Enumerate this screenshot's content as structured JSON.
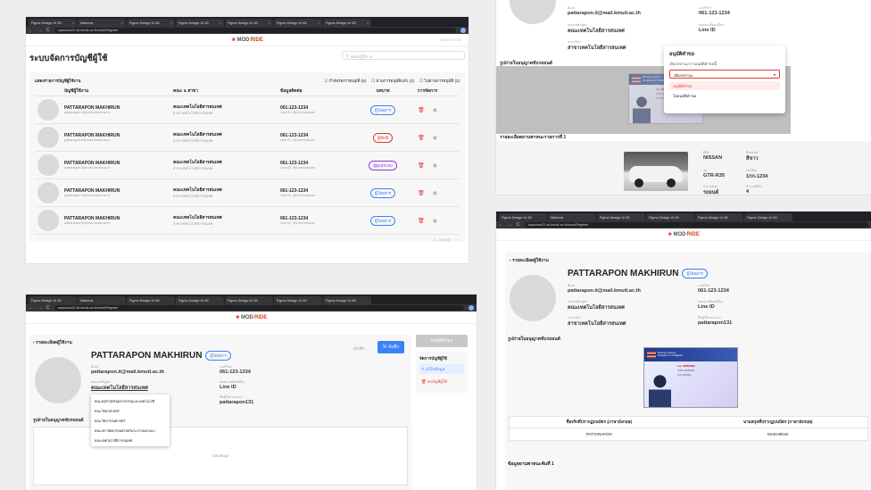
{
  "browser": {
    "tab_labels": [
      "Figma Design UI 65",
      "Mainmal",
      "Figma Design UI 65",
      "Figma Design UI 65",
      "Figma Design UI 65",
      "Figma Design UI 65",
      "Figma Design UI 65"
    ],
    "url": "capstone22.sit.kmutt.ac.th/mod/Register"
  },
  "app": {
    "logo_text": "MOD",
    "logo_accent": "RIDE",
    "logout": "ออกจากระบบ"
  },
  "list_page": {
    "title": "ระบบจัดการบัญชีผู้ใช้",
    "search_placeholder": "ค้นหาผู้ใช้งาน",
    "table_caption": "แสดงรายการบัญชีผู้ใช้งาน",
    "filters": [
      "กำลังรอการอนุมัติ (5)",
      "ผ่านการอนุมัติแล้ว (2)",
      "ไม่ผ่านการอนุมัติ (2)"
    ],
    "headers": [
      "บัญชีผู้ใช้งาน",
      "คณะ & สาขา",
      "ข้อมูลติดต่อ",
      "บทบาท",
      "การจัดการ"
    ],
    "rows": [
      {
        "name": "PATTARAPON MAKHIRUN",
        "email": "pattarapon.it@mail.kmutt.ac.th",
        "faculty": "คณะเทคโนโลยีสารสนเทศ",
        "major": "สาขาเทคโนโลยีสารสนเทศ",
        "phone": "061-123-1234",
        "line": "Line ID: @LoremIpsum",
        "role": "ผู้โดยสาร",
        "role_color": "blue"
      },
      {
        "name": "PATTARAPON MAKHIRUN",
        "email": "pattarapon.it@mail.kmutt.ac.th",
        "faculty": "คณะเทคโนโลยีสารสนเทศ",
        "major": "สาขาเทคโนโลยีสารสนเทศ",
        "phone": "061-123-1234",
        "line": "Line ID: @LoremIpsum",
        "role": "ผู้ขับขี่",
        "role_color": "red"
      },
      {
        "name": "PATTARAPON MAKHIRUN",
        "email": "pattarapon.it@mail.kmutt.ac.th",
        "faculty": "คณะเทคโนโลยีสารสนเทศ",
        "major": "สาขาเทคโนโลยีสารสนเทศ",
        "phone": "061-123-1234",
        "line": "Line ID: @LoremIpsum",
        "role": "ผู้ดูแลระบบ",
        "role_color": "purple"
      },
      {
        "name": "PATTARAPON MAKHIRUN",
        "email": "pattarapon.it@mail.kmutt.ac.th",
        "faculty": "คณะเทคโนโลยีสารสนเทศ",
        "major": "สาขาเทคโนโลยีสารสนเทศ",
        "phone": "061-123-1234",
        "line": "Line ID: @LoremIpsum",
        "role": "ผู้โดยสาร",
        "role_color": "blue"
      },
      {
        "name": "PATTARAPON MAKHIRUN",
        "email": "pattarapon.it@mail.kmutt.ac.th",
        "faculty": "คณะเทคโนโลยีสารสนเทศ",
        "major": "สาขาเทคโนโลยีสารสนเทศ",
        "phone": "061-123-1234",
        "line": "Line ID: @LoremIpsum",
        "role": "ผู้โดยสาร",
        "role_color": "blue"
      }
    ],
    "pagination": "1 - 5 of 50"
  },
  "approve_page": {
    "email_label": "อีเมล",
    "email": "pattarapon.it@mail.kmutt.ac.th",
    "phone_label": "เบอร์โทร",
    "phone": "061-123-1234",
    "faculty_label": "คณะ/หลักสูตร",
    "faculty": "คณะเทคโนโลยีสารสนเทศ",
    "line_label": "ช่องทางติดต่ออื่นๆ",
    "line": "Line ID",
    "major_label": "สาขาวิชา",
    "major": "สาขาเทคโนโลยีสารสนเทศ",
    "license_title": "รูปถ่ายใบอนุญาตขับรถยนต์",
    "dialog": {
      "title": "อนุมัติคำขอ",
      "subtitle": "เลือกสถานะการอนุมัติคำขอนี้",
      "select_placeholder": "เลือกสถานะ",
      "options": [
        "อนุมัติคำขอ",
        "ไม่อนุมัติคำขอ"
      ]
    },
    "car_title": "รายละเอียดยานพาหนะรายการที่ 1",
    "car": {
      "brand_label": "ยี่ห้อ",
      "brand": "NISSAN",
      "color_label": "สีรถยนต์",
      "color": "สีขาว",
      "model_label": "รุ่น",
      "model": "GTR-R35",
      "plate_label": "ทะเบียน",
      "plate": "1กก-1234",
      "type_label": "ประเภทรถ",
      "type": "รถยนต์",
      "seats_label": "จำนวนที่นั่ง",
      "seats": "4"
    }
  },
  "edit_page": {
    "back": "รายละเอียดผู้ใช้งาน",
    "name": "PATTARAPON MAKHIRUN",
    "role": "ผู้โดยสาร",
    "cancel": "ยกเลิก",
    "save": "บันทึก",
    "email_label": "อีเมล",
    "email": "pattarapon.it@mail.kmutt.ac.th",
    "phone_label": "เบอร์โทร",
    "phone": "061-123-1234",
    "faculty_label": "คณะ/หลักสูตร",
    "faculty": "คณะเทคโนโลยีสารสนเทศ",
    "line_label": "ช่องทางติดต่ออื่นๆ",
    "line": "Line ID",
    "username_label": "ชื่อผู้ใช้งานระบบ",
    "username": "pattarapon131",
    "faculty_options": [
      "คณะครุศาสตร์อุตสาหกรรมและเทคโนโลยี",
      "คณะวิทยาศาสตร์",
      "คณะวิศวกรรมศาสตร์",
      "คณะสถาปัตยกรรมศาสตร์และการออกแบบ",
      "คณะเทคโนโลยีสารสนเทศ"
    ],
    "license_title": "รูปถ่ายใบอนุญาตขับรถยนต์",
    "no_data": "ไม่พบข้อมูล",
    "side": {
      "approve": "อนุมัติคำขอ",
      "manage_title": "จัดการบัญชีผู้ใช้",
      "edit": "แก้ไขข้อมูล",
      "delete": "ลบบัญชีผู้ใช้"
    }
  },
  "detail_page": {
    "back": "รายละเอียดผู้ใช้งาน",
    "name": "PATTARAPON MAKHIRUN",
    "role": "ผู้โดยสาร",
    "email_label": "อีเมล",
    "email": "pattarapon.it@mail.kmutt.ac.th",
    "phone_label": "เบอร์โทร",
    "phone": "061-123-1234",
    "faculty_label": "คณะ/หลักสูตร",
    "faculty": "คณะเทคโนโลยีสารสนเทศ",
    "line_label": "ช่องทางติดต่ออื่นๆ",
    "line": "Line ID",
    "major_label": "สาขาวิชา",
    "major": "สาขาเทคโนโลยีสารสนเทศ",
    "username_label": "ชื่อผู้ใช้งานระบบ",
    "username": "pattarapon131",
    "license_title": "รูปถ่ายใบอนุญาตขับรถยนต์",
    "table_headers": [
      "ชื่อจริงที่ปรากฏบนบัตร (ภาษาอังกฤษ)",
      "นามสกุลที่ปรากฏบนบัตร (ภาษาอังกฤษ)"
    ],
    "table_values": [
      "PATTARAPON",
      "MAKHIRUN"
    ],
    "vehicle_title": "ข้อมูลยานพาหนะคันที่ 1"
  },
  "license_card": {
    "header": "Driving Licence",
    "country": "Kingdom of Thailand",
    "number": "Lic. 00000000",
    "fake_lines": [
      "XXX XXXXXX",
      "XX XXXXX"
    ]
  }
}
